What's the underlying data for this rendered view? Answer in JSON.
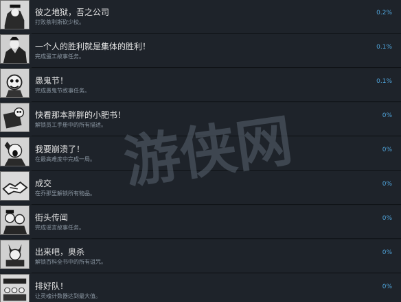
{
  "achievements": [
    {
      "title": "彼之地狱，吾之公司",
      "desc": "打败茶利斯砍少校。",
      "percent": "0.2%",
      "icon": "soldier-portrait-icon"
    },
    {
      "title": "一个人的胜利就是集体的胜利！",
      "desc": "完成蛋工故事任务。",
      "percent": "0.1%",
      "icon": "worker-crowd-icon"
    },
    {
      "title": "愚鬼节！",
      "desc": "完成愚鬼节故事任务。",
      "percent": "0.1%",
      "icon": "jester-ghost-icon"
    },
    {
      "title": "快看那本胖胖的小肥书！",
      "desc": "解锁员工手册中的所有描述。",
      "percent": "0%",
      "icon": "handbook-character-icon"
    },
    {
      "title": "我要崩溃了！",
      "desc": "在最高难度中完成一局。",
      "percent": "0%",
      "icon": "screaming-face-icon"
    },
    {
      "title": "成交",
      "desc": "在乔那里解锁所有物品。",
      "percent": "0%",
      "icon": "handshake-icon"
    },
    {
      "title": "街头传闻",
      "desc": "完成谣言故事任务。",
      "percent": "0%",
      "icon": "whisper-character-icon"
    },
    {
      "title": "出来吧，奥杀",
      "desc": "解锁百科全书中的所有诅咒。",
      "percent": "0%",
      "icon": "demon-book-icon"
    },
    {
      "title": "排好队！",
      "desc": "让灵魂计数器达到最大值。",
      "percent": "0%",
      "icon": "queue-crowd-icon"
    }
  ],
  "watermark": {
    "text": "游侠网",
    "color": "#5a6470"
  }
}
